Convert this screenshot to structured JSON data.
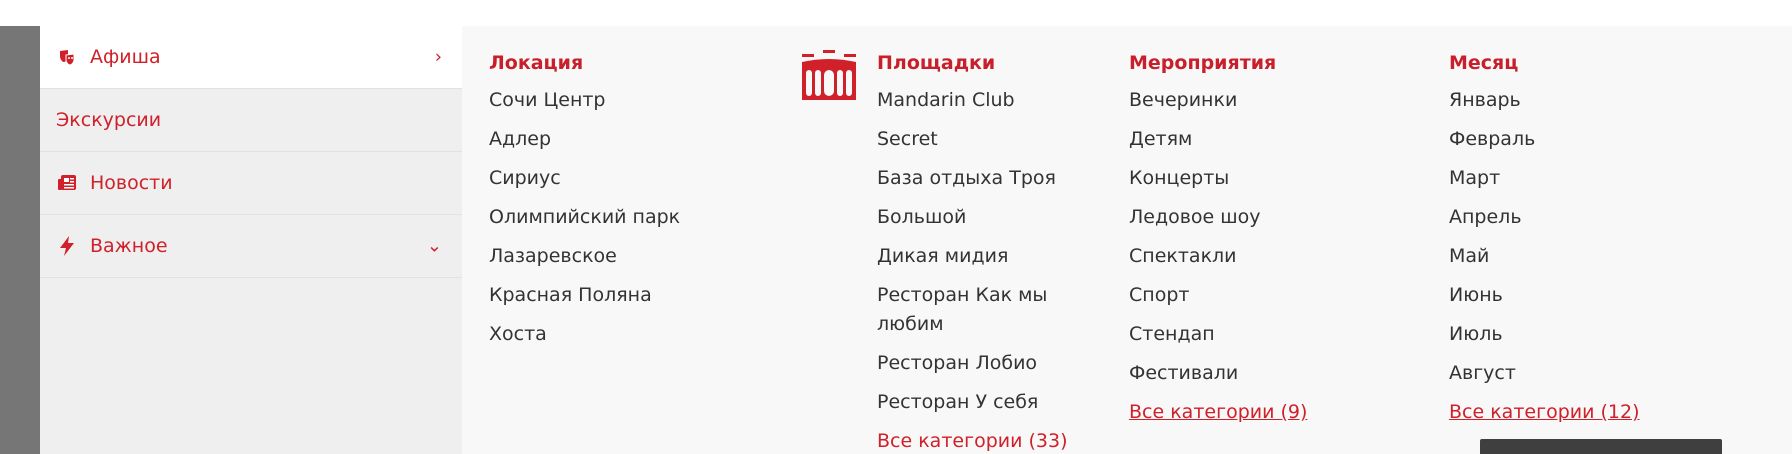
{
  "sidebar": {
    "items": [
      {
        "label": "Афиша",
        "icon": "theater-masks-icon",
        "chevron": "›"
      },
      {
        "label": "Экскурсии"
      },
      {
        "label": "Новости",
        "icon": "newspaper-icon"
      },
      {
        "label": "Важное",
        "icon": "lightning-icon",
        "chevron": "⌄"
      }
    ]
  },
  "columns": {
    "location": {
      "title": "Локация",
      "items": [
        "Сочи Центр",
        "Адлер",
        "Сириус",
        "Олимпийский парк",
        "Лазаревское",
        "Красная Поляна",
        "Хоста"
      ]
    },
    "venues": {
      "title": "Площадки",
      "icon": "venue-building-icon",
      "items": [
        "Mandarin Club",
        "Secret",
        "База отдыха Троя",
        "Большой",
        "Дикая мидия",
        "Ресторан Как мы любим",
        "Ресторан Лобио",
        "Ресторан У себя"
      ],
      "all": "Все категории (33)"
    },
    "events": {
      "title": "Мероприятия",
      "items": [
        "Вечеринки",
        "Детям",
        "Концерты",
        "Ледовое шоу",
        "Спектакли",
        "Спорт",
        "Стендап",
        "Фестивали"
      ],
      "all": "Все категории (9)"
    },
    "month": {
      "title": "Месяц",
      "items": [
        "Январь",
        "Февраль",
        "Март",
        "Апрель",
        "Май",
        "Июнь",
        "Июль",
        "Август"
      ],
      "all": "Все категории (12)"
    }
  },
  "colors": {
    "accent": "#d0202a",
    "text": "#333333",
    "panel_bg": "#f8f8f8",
    "sidebar_bg": "#efefef"
  }
}
